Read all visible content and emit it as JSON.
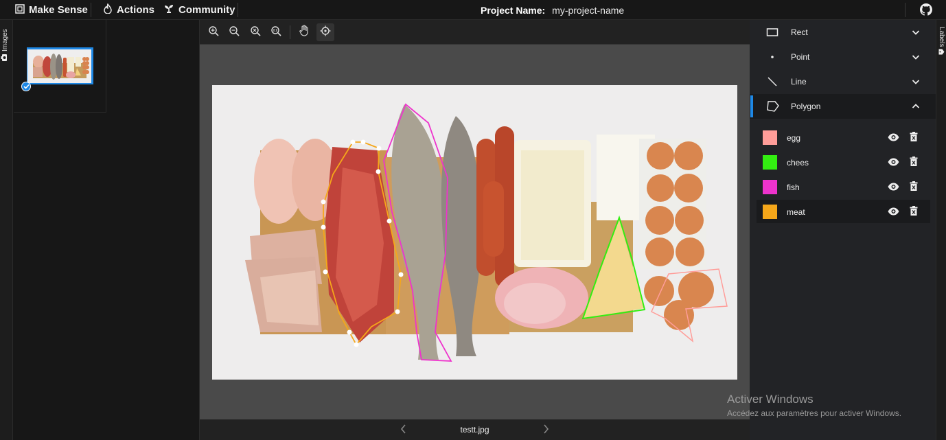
{
  "topbar": {
    "brand": "Make Sense",
    "actions": "Actions",
    "community": "Community",
    "project_label": "Project Name:",
    "project_name": "my-project-name"
  },
  "left_rail": {
    "label": "Images"
  },
  "right_rail": {
    "label": "Labels"
  },
  "editor": {
    "filename": "testt.jpg",
    "tools": [
      "zoom-in-icon",
      "zoom-out-icon",
      "zoom-fit-icon",
      "zoom-actual-icon",
      "pan-hand-icon",
      "crosshair-icon"
    ]
  },
  "label_tools": [
    {
      "name": "Rect",
      "expanded": false
    },
    {
      "name": "Point",
      "expanded": false
    },
    {
      "name": "Line",
      "expanded": false
    },
    {
      "name": "Polygon",
      "expanded": true
    }
  ],
  "labels": [
    {
      "name": "egg",
      "color": "#ff9d99"
    },
    {
      "name": "chees",
      "color": "#33ee11"
    },
    {
      "name": "fish",
      "color": "#ee33cc"
    },
    {
      "name": "meat",
      "color": "#f5a71a"
    }
  ],
  "colors": {
    "accent": "#1e88e5"
  },
  "watermark": {
    "title": "Activer Windows",
    "subtitle": "Accédez aux paramètres pour activer Windows."
  }
}
